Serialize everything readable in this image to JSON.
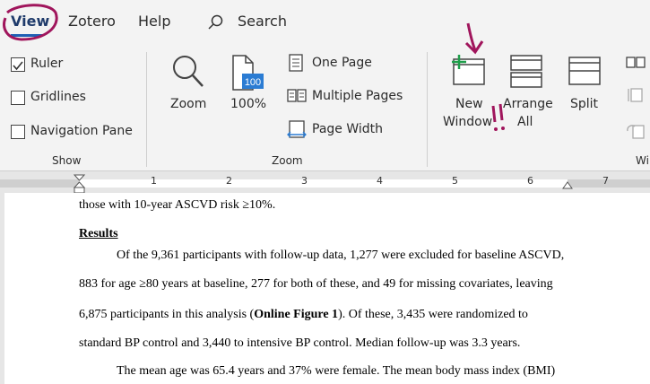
{
  "tabs": {
    "view": "View",
    "zotero": "Zotero",
    "help": "Help",
    "search": "Search"
  },
  "show_group": {
    "label": "Show",
    "ruler": {
      "label": "Ruler",
      "checked": true
    },
    "gridlines": {
      "label": "Gridlines",
      "checked": false
    },
    "navigation_pane": {
      "label": "Navigation Pane",
      "checked": false
    }
  },
  "zoom_group": {
    "label": "Zoom",
    "zoom": "Zoom",
    "hundred": "100%",
    "hundred_badge": "100",
    "one_page": "One Page",
    "multiple_pages": "Multiple Pages",
    "page_width": "Page Width"
  },
  "window_group": {
    "new_window": [
      "New",
      "Window"
    ],
    "arrange_all": [
      "Arrange",
      "All"
    ],
    "split": "Split",
    "label_partial": "Wi"
  },
  "ruler": {
    "numbers": [
      "1",
      "2",
      "3",
      "4",
      "5",
      "6",
      "7"
    ]
  },
  "document": {
    "line0": "those with 10-year ASCVD risk ≥10%.",
    "heading": "Results",
    "p1": [
      "Of the 9,361 participants with follow-up data, 1,277 were excluded for baseline ASCVD,",
      "883 for age ≥80 years at baseline, 277 for both of these, and 49 for missing covariates, leaving"
    ],
    "p1_line3_pre": "6,875 participants in this analysis (",
    "p1_line3_bold": "Online Figure 1",
    "p1_line3_post": "). Of these, 3,435 were randomized to",
    "p1_line4": "standard BP control and 3,440 to intensive BP control. Median follow-up was 3.3 years.",
    "p2": "The mean age was 65.4 years and 37% were female. The mean body mass index (BMI)"
  },
  "colors": {
    "accent": "#1f5fb4",
    "annotation": "#a0155c",
    "new_window_plus": "#1e9e4a"
  }
}
